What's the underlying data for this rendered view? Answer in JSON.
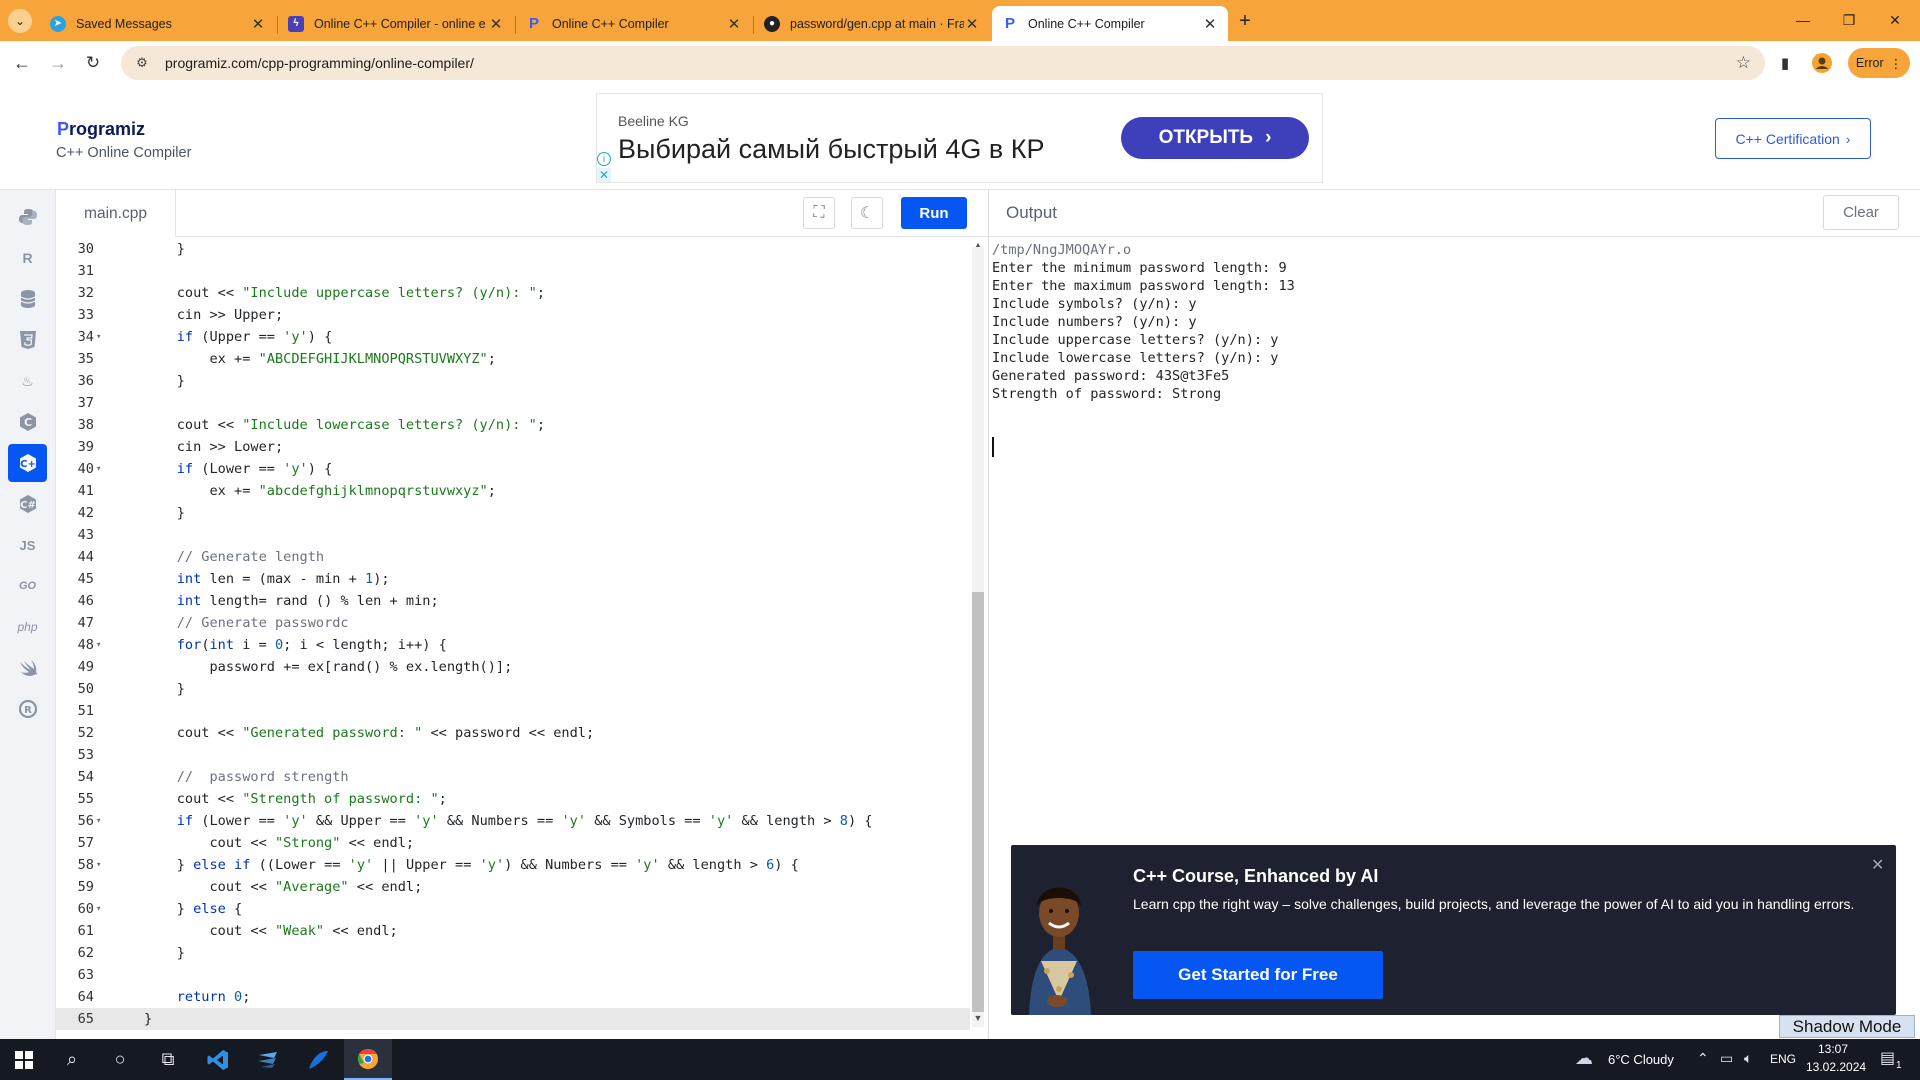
{
  "browser": {
    "tabs": [
      {
        "title": "Saved Messages",
        "icon": "telegram-icon",
        "color": "#2aa3e0"
      },
      {
        "title": "Online C++ Compiler - online e",
        "icon": "compiler-icon",
        "color": "#4b3fb5"
      },
      {
        "title": "Online C++ Compiler",
        "icon": "programiz-icon",
        "color": "#3d5af1"
      },
      {
        "title": "password/gen.cpp at main · Fra",
        "icon": "github-icon",
        "color": "#222222"
      },
      {
        "title": "Online C++ Compiler",
        "icon": "programiz-icon",
        "color": "#3d5af1"
      }
    ],
    "url": "programiz.com/cpp-programming/online-compiler/",
    "profile_status": "Error",
    "accent_color": "#f7a53a"
  },
  "site": {
    "logo_text": "rogramiz",
    "logo_initial": "P",
    "subtitle": "C++ Online Compiler",
    "cert_button": "C++ Certification",
    "ad": {
      "brand": "Beeline KG",
      "headline": "Выбирай самый быстрый 4G в КР",
      "cta": "ОТКРЫТЬ"
    }
  },
  "rail": {
    "items": [
      "python-icon",
      "r-icon",
      "sql-icon",
      "html-icon",
      "java-icon",
      "c-icon",
      "cpp-icon",
      "csharp-icon",
      "js-icon",
      "go-icon",
      "php-icon",
      "swift-icon",
      "rust-icon"
    ],
    "labels": {
      "js": "JS",
      "go": "GO",
      "php": "php"
    },
    "active_index": 6
  },
  "editor": {
    "file_name": "main.cpp",
    "run_label": "Run",
    "current_line": 65,
    "lines": [
      {
        "n": 30,
        "fold": false,
        "code": "    }"
      },
      {
        "n": 31,
        "fold": false,
        "code": ""
      },
      {
        "n": 32,
        "fold": false,
        "code": "    cout << \"Include uppercase letters? (y/n): \";"
      },
      {
        "n": 33,
        "fold": false,
        "code": "    cin >> Upper;"
      },
      {
        "n": 34,
        "fold": true,
        "code": "    if (Upper == 'y') {"
      },
      {
        "n": 35,
        "fold": false,
        "code": "        ex += \"ABCDEFGHIJKLMNOPQRSTUVWXYZ\";"
      },
      {
        "n": 36,
        "fold": false,
        "code": "    }"
      },
      {
        "n": 37,
        "fold": false,
        "code": ""
      },
      {
        "n": 38,
        "fold": false,
        "code": "    cout << \"Include lowercase letters? (y/n): \";"
      },
      {
        "n": 39,
        "fold": false,
        "code": "    cin >> Lower;"
      },
      {
        "n": 40,
        "fold": true,
        "code": "    if (Lower == 'y') {"
      },
      {
        "n": 41,
        "fold": false,
        "code": "        ex += \"abcdefghijklmnopqrstuvwxyz\";"
      },
      {
        "n": 42,
        "fold": false,
        "code": "    }"
      },
      {
        "n": 43,
        "fold": false,
        "code": ""
      },
      {
        "n": 44,
        "fold": false,
        "code": "    // Generate length"
      },
      {
        "n": 45,
        "fold": false,
        "code": "    int len = (max - min + 1);"
      },
      {
        "n": 46,
        "fold": false,
        "code": "    int length= rand () % len + min;"
      },
      {
        "n": 47,
        "fold": false,
        "code": "    // Generate passwordc"
      },
      {
        "n": 48,
        "fold": true,
        "code": "    for(int i = 0; i < length; i++) {"
      },
      {
        "n": 49,
        "fold": false,
        "code": "        password += ex[rand() % ex.length()];"
      },
      {
        "n": 50,
        "fold": false,
        "code": "    }"
      },
      {
        "n": 51,
        "fold": false,
        "code": ""
      },
      {
        "n": 52,
        "fold": false,
        "code": "    cout << \"Generated password: \" << password << endl;"
      },
      {
        "n": 53,
        "fold": false,
        "code": ""
      },
      {
        "n": 54,
        "fold": false,
        "code": "    //  password strength"
      },
      {
        "n": 55,
        "fold": false,
        "code": "    cout << \"Strength of password: \";"
      },
      {
        "n": 56,
        "fold": true,
        "code": "    if (Lower == 'y' && Upper == 'y' && Numbers == 'y' && Symbols == 'y' && length > 8) {"
      },
      {
        "n": 57,
        "fold": false,
        "code": "        cout << \"Strong\" << endl;"
      },
      {
        "n": 58,
        "fold": true,
        "code": "    } else if ((Lower == 'y' || Upper == 'y') && Numbers == 'y' && length > 6) {"
      },
      {
        "n": 59,
        "fold": false,
        "code": "        cout << \"Average\" << endl;"
      },
      {
        "n": 60,
        "fold": true,
        "code": "    } else {"
      },
      {
        "n": 61,
        "fold": false,
        "code": "        cout << \"Weak\" << endl;"
      },
      {
        "n": 62,
        "fold": false,
        "code": "    }"
      },
      {
        "n": 63,
        "fold": false,
        "code": ""
      },
      {
        "n": 64,
        "fold": false,
        "code": "    return 0;"
      },
      {
        "n": 65,
        "fold": false,
        "code": "}"
      }
    ]
  },
  "output": {
    "title": "Output",
    "clear_label": "Clear",
    "lines": [
      "/tmp/NngJMOQAYr.o",
      "Enter the minimum password length: 9",
      "Enter the maximum password length: 13",
      "Include symbols? (y/n): y",
      "Include numbers? (y/n): y",
      "Include uppercase letters? (y/n): y",
      "Include lowercase letters? (y/n): y",
      "Generated password: 43S@t3Fe5",
      "Strength of password: Strong"
    ]
  },
  "promo": {
    "title": "C++ Course, Enhanced by AI",
    "description": "Learn cpp the right way – solve challenges, build projects, and leverage the power of AI to aid you in handling errors.",
    "cta": "Get Started for Free"
  },
  "shadow_mode_label": "Shadow Mode",
  "taskbar": {
    "weather": "6°C  Cloudy",
    "language": "ENG",
    "time": "13:07",
    "date": "13.02.2024",
    "notification_count": "1"
  }
}
